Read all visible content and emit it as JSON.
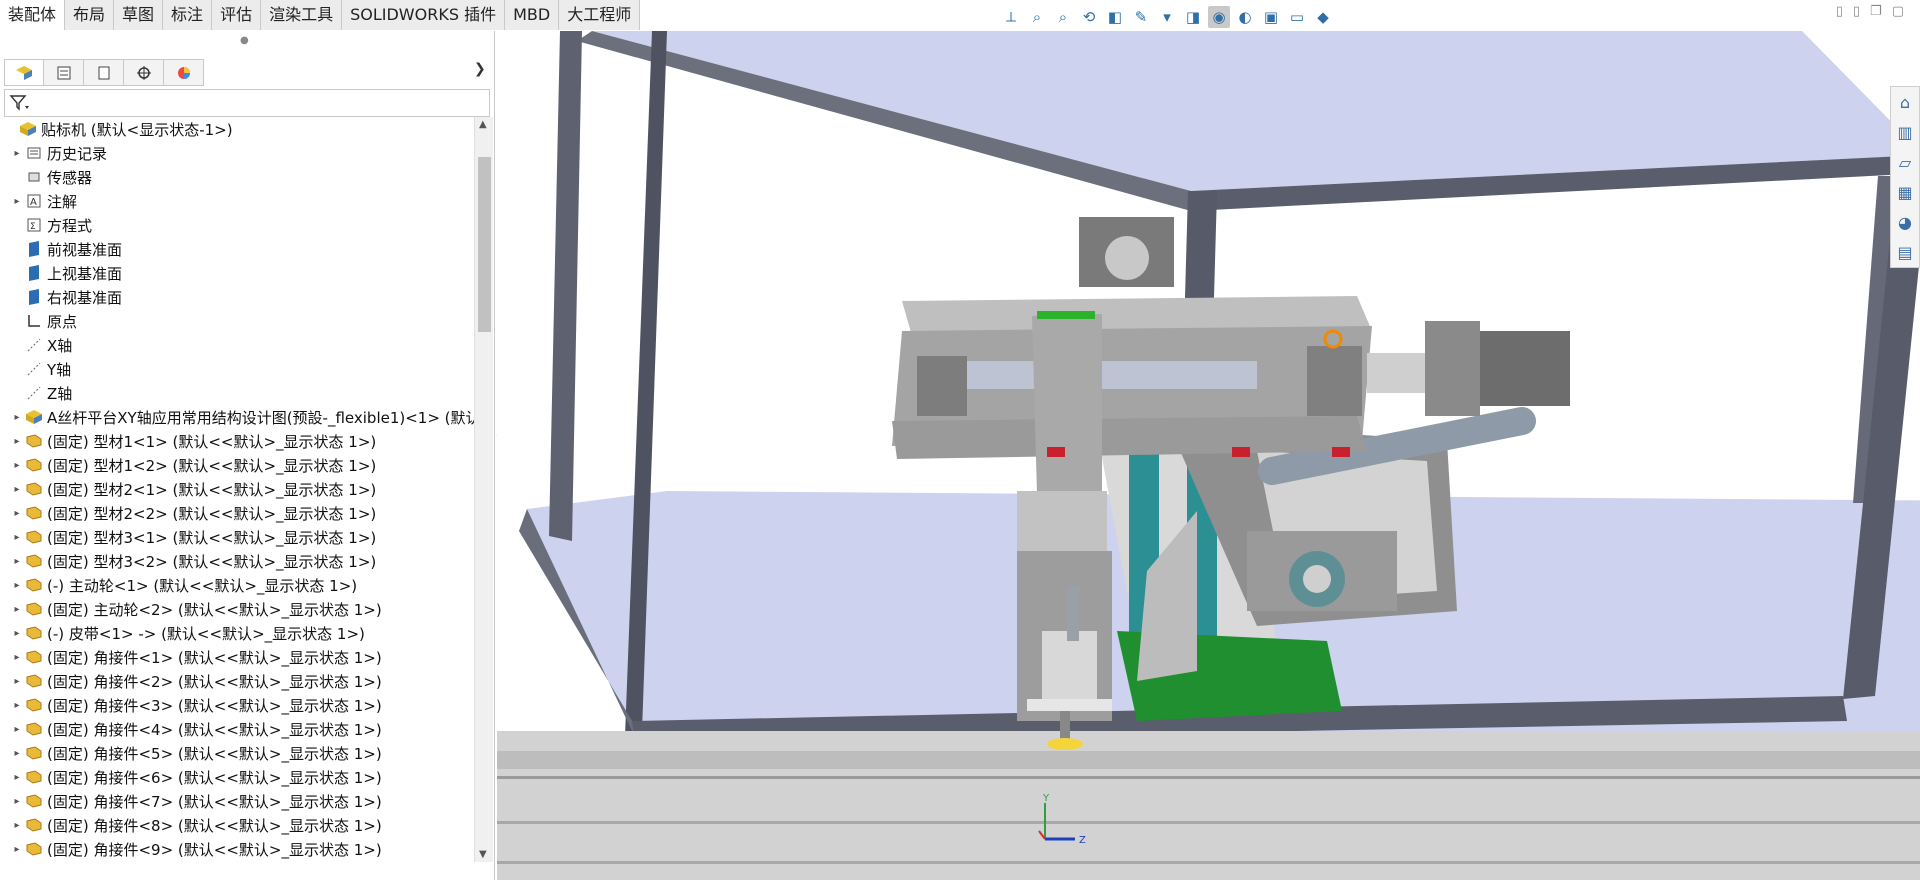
{
  "command_tabs": [
    "装配体",
    "布局",
    "草图",
    "标注",
    "评估",
    "渲染工具",
    "SOLIDWORKS 插件",
    "MBD",
    "大工程师"
  ],
  "hud_icons": [
    "view-orientation-icon",
    "zoom-to-fit-icon",
    "zoom-area-icon",
    "previous-view-icon",
    "section-view-icon",
    "dynamic-annotation-icon",
    "view-orientation-dropdown-icon",
    "display-style-icon",
    "hide-show-items-icon",
    "edit-appearance-icon",
    "apply-scene-icon",
    "view-settings-icon",
    "display-icon"
  ],
  "feature_manager": {
    "tabs": [
      "featuremanager-tab-icon",
      "propertymanager-tab-icon",
      "configurationmanager-tab-icon",
      "dimxpertmanager-tab-icon",
      "displaymanager-tab-icon"
    ],
    "root": "贴标机  (默认<显示状态-1>)",
    "items": [
      {
        "label": "历史记录",
        "icon": "history-icon",
        "exp": true
      },
      {
        "label": "传感器",
        "icon": "sensor-icon",
        "exp": false
      },
      {
        "label": "注解",
        "icon": "annotation-icon",
        "exp": true
      },
      {
        "label": "方程式",
        "icon": "equation-icon",
        "exp": false
      },
      {
        "label": "前视基准面",
        "icon": "plane-icon",
        "exp": false
      },
      {
        "label": "上视基准面",
        "icon": "plane-icon",
        "exp": false
      },
      {
        "label": "右视基准面",
        "icon": "plane-icon",
        "exp": false
      },
      {
        "label": "原点",
        "icon": "origin-icon",
        "exp": false
      },
      {
        "label": "X轴",
        "icon": "axis-icon",
        "exp": false
      },
      {
        "label": "Y轴",
        "icon": "axis-icon",
        "exp": false
      },
      {
        "label": "Z轴",
        "icon": "axis-icon",
        "exp": false
      },
      {
        "label": "A丝杆平台XY轴应用常用结构设计图(预設-_flexible1)<1> (默认",
        "icon": "assembly-icon",
        "exp": true
      },
      {
        "label": "(固定) 型材1<1> (默认<<默认>_显示状态 1>)",
        "icon": "part-icon",
        "exp": true
      },
      {
        "label": "(固定) 型材1<2> (默认<<默认>_显示状态 1>)",
        "icon": "part-icon",
        "exp": true
      },
      {
        "label": "(固定) 型材2<1> (默认<<默认>_显示状态 1>)",
        "icon": "part-icon",
        "exp": true
      },
      {
        "label": "(固定) 型材2<2> (默认<<默认>_显示状态 1>)",
        "icon": "part-icon",
        "exp": true
      },
      {
        "label": "(固定) 型材3<1> (默认<<默认>_显示状态 1>)",
        "icon": "part-icon",
        "exp": true
      },
      {
        "label": "(固定) 型材3<2> (默认<<默认>_显示状态 1>)",
        "icon": "part-icon",
        "exp": true
      },
      {
        "label": "(-) 主动轮<1> (默认<<默认>_显示状态 1>)",
        "icon": "part-icon",
        "exp": true
      },
      {
        "label": "(固定) 主动轮<2> (默认<<默认>_显示状态 1>)",
        "icon": "part-icon",
        "exp": true
      },
      {
        "label": "(-) 皮带<1> -> (默认<<默认>_显示状态 1>)",
        "icon": "part-icon",
        "exp": true
      },
      {
        "label": "(固定) 角接件<1> (默认<<默认>_显示状态 1>)",
        "icon": "part-icon",
        "exp": true
      },
      {
        "label": "(固定) 角接件<2> (默认<<默认>_显示状态 1>)",
        "icon": "part-icon",
        "exp": true
      },
      {
        "label": "(固定) 角接件<3> (默认<<默认>_显示状态 1>)",
        "icon": "part-icon",
        "exp": true
      },
      {
        "label": "(固定) 角接件<4> (默认<<默认>_显示状态 1>)",
        "icon": "part-icon",
        "exp": true
      },
      {
        "label": "(固定) 角接件<5> (默认<<默认>_显示状态 1>)",
        "icon": "part-icon",
        "exp": true
      },
      {
        "label": "(固定) 角接件<6> (默认<<默认>_显示状态 1>)",
        "icon": "part-icon",
        "exp": true
      },
      {
        "label": "(固定) 角接件<7> (默认<<默认>_显示状态 1>)",
        "icon": "part-icon",
        "exp": true
      },
      {
        "label": "(固定) 角接件<8> (默认<<默认>_显示状态 1>)",
        "icon": "part-icon",
        "exp": true
      },
      {
        "label": "(固定) 角接件<9> (默认<<默认>_显示状态 1>)",
        "icon": "part-icon",
        "exp": true
      }
    ]
  },
  "task_pane": [
    "solidworks-resources-icon",
    "design-library-icon",
    "file-explorer-icon",
    "view-palette-icon",
    "appearances-icon",
    "custom-properties-icon"
  ],
  "triad": {
    "y": "Y",
    "z": "Z"
  },
  "colors": {
    "frame": "#5a5d6b",
    "plane": "#cdd2ee",
    "part_gray": "#a4a4a4",
    "green": "#1f8f2f",
    "teal": "#2c8f93"
  }
}
